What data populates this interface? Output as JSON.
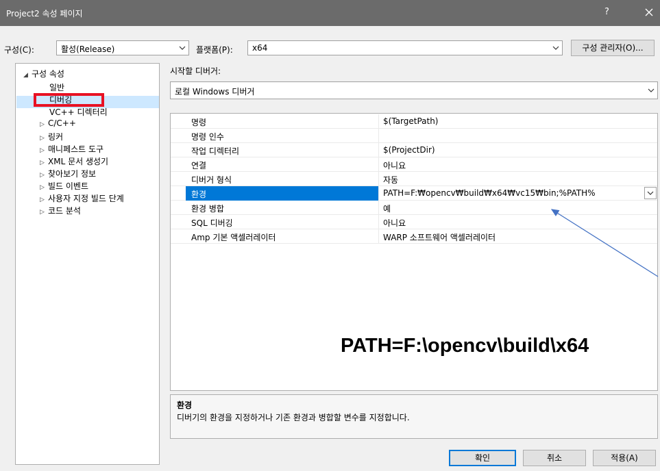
{
  "window": {
    "title": "Project2 속성 페이지",
    "help_label": "?",
    "close_icon": "close-icon"
  },
  "toolbar": {
    "config_label": "구성(C):",
    "config_value": "활성(Release)",
    "platform_label": "플랫폼(P):",
    "platform_value": "x64",
    "config_manager_label": "구성 관리자(O)..."
  },
  "tree": {
    "root": "구성 속성",
    "items": [
      {
        "label": "일반",
        "expandable": false
      },
      {
        "label": "디버깅",
        "expandable": false
      },
      {
        "label": "VC++ 디렉터리",
        "expandable": false
      },
      {
        "label": "C/C++",
        "expandable": true
      },
      {
        "label": "링커",
        "expandable": true
      },
      {
        "label": "매니페스트 도구",
        "expandable": true
      },
      {
        "label": "XML 문서 생성기",
        "expandable": true
      },
      {
        "label": "찾아보기 정보",
        "expandable": true
      },
      {
        "label": "빌드 이벤트",
        "expandable": true
      },
      {
        "label": "사용자 지정 빌드 단계",
        "expandable": true
      },
      {
        "label": "코드 분석",
        "expandable": true
      }
    ]
  },
  "debugger": {
    "label": "시작할 디버거:",
    "value": "로컬 Windows 디버거"
  },
  "properties": [
    {
      "name": "명령",
      "value": "$(TargetPath)"
    },
    {
      "name": "명령 인수",
      "value": ""
    },
    {
      "name": "작업 디렉터리",
      "value": "$(ProjectDir)"
    },
    {
      "name": "연결",
      "value": "아니요"
    },
    {
      "name": "디버거 형식",
      "value": "자동"
    },
    {
      "name": "환경",
      "value": "PATH=F:₩opencv₩build₩x64₩vc15₩bin;%PATH%"
    },
    {
      "name": "환경 병합",
      "value": "예"
    },
    {
      "name": "SQL 디버깅",
      "value": "아니요"
    },
    {
      "name": "Amp 기본 액셀러레이터",
      "value": "WARP 소프트웨어 액셀러레이터"
    }
  ],
  "annotation": {
    "text": "PATH=F:\\opencv\\build\\x64",
    "arrow_color": "#4472c4"
  },
  "description": {
    "title": "환경",
    "text": "디버기의 환경을 지정하거나 기존 환경과 병합할 변수를 지정합니다."
  },
  "buttons": {
    "ok": "확인",
    "cancel": "취소",
    "apply": "적용(A)"
  },
  "colors": {
    "titlebar": "#6b6b6b",
    "selection": "#0078d7",
    "highlight_box": "#e81123"
  }
}
